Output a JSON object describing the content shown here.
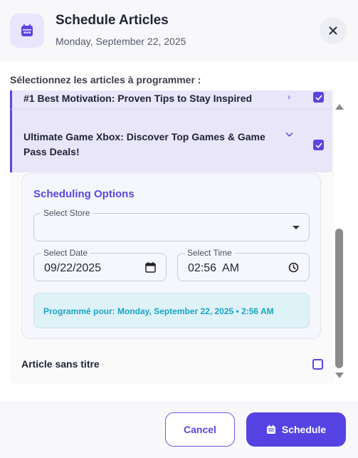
{
  "header": {
    "title": "Schedule Articles",
    "date": "Monday, September 22, 2025",
    "icon": "calendar-icon",
    "close_icon": "close-icon"
  },
  "select_label": "Sélectionnez les articles à programmer :",
  "articles": [
    {
      "title": "#1 Best Motivation: Proven Tips to Stay Inspired",
      "checked": true
    },
    {
      "title": "Ultimate Game Xbox: Discover Top Games & Game Pass Deals!",
      "checked": true,
      "expanded": true
    },
    {
      "title": "Article sans titre",
      "checked": false
    }
  ],
  "scheduling": {
    "title": "Scheduling Options",
    "store_label": "Select Store",
    "store_value": "",
    "date_label": "Select Date",
    "date_value": "09/22/2025",
    "time_label": "Select Time",
    "time_value": "02:56  AM",
    "note": "Programmé pour: Monday, September 22, 2025 • 2:56 AM"
  },
  "footer": {
    "cancel_label": "Cancel",
    "schedule_label": "Schedule"
  },
  "colors": {
    "accent": "#5b45e0",
    "info_text": "#17a5c4",
    "info_bg": "#dff2f8"
  }
}
